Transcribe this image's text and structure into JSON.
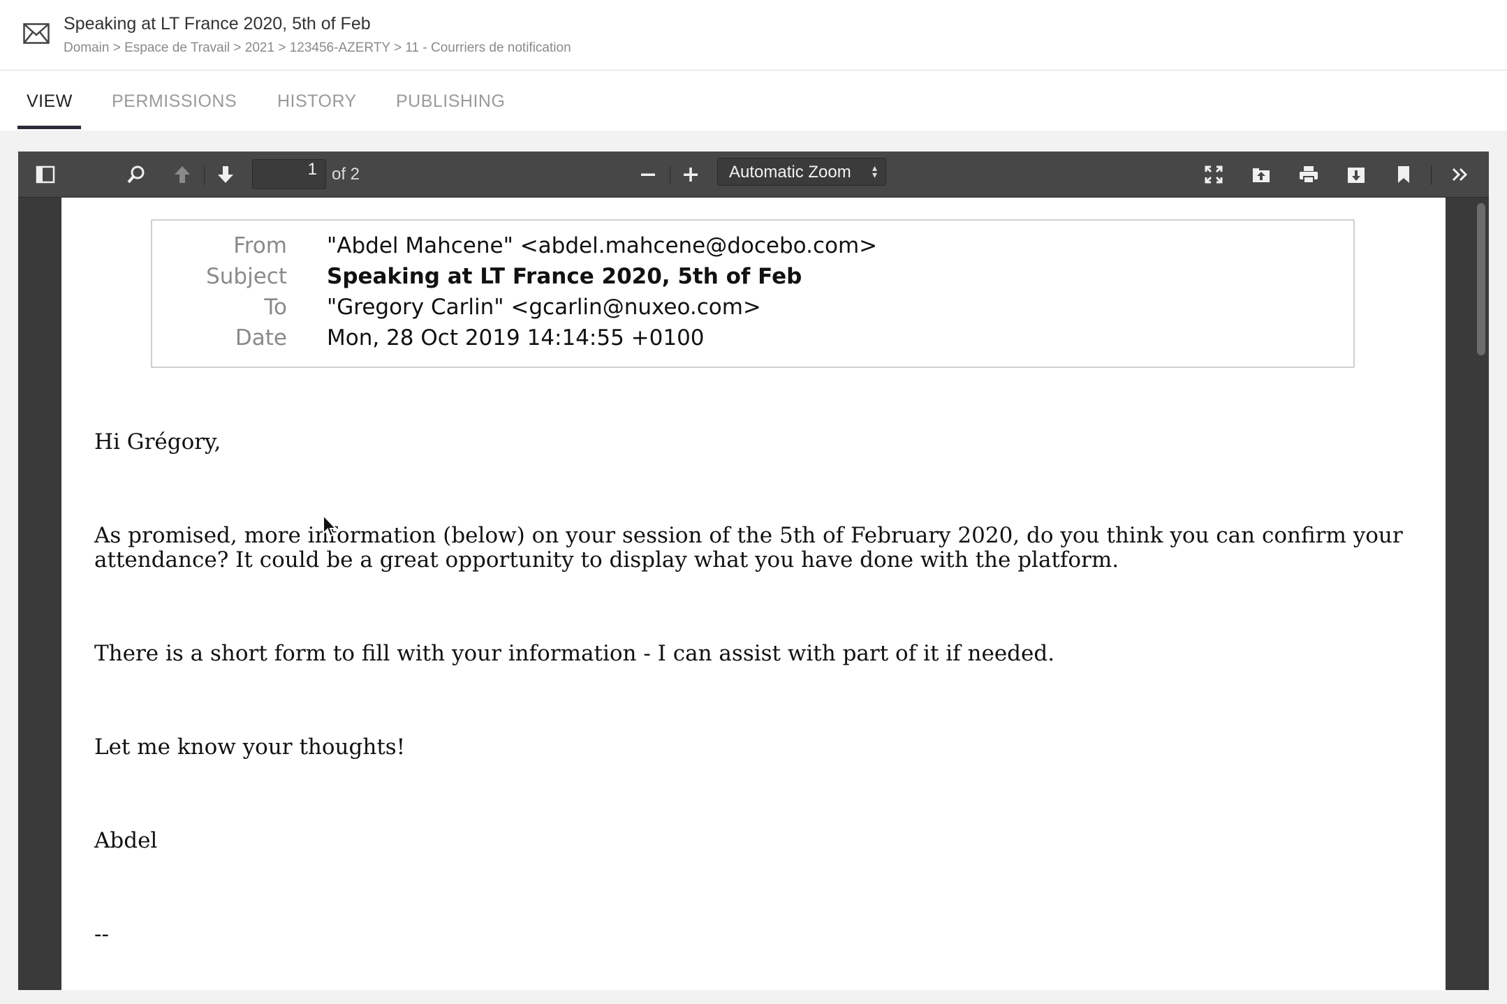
{
  "header": {
    "title": "Speaking at LT France 2020, 5th of Feb",
    "breadcrumb": "Domain > Espace de Travail > 2021 > 123456-AZERTY > 11 - Courriers de notification",
    "icon": "envelope-icon"
  },
  "tabs": [
    {
      "label": "VIEW",
      "active": true
    },
    {
      "label": "PERMISSIONS",
      "active": false
    },
    {
      "label": "HISTORY",
      "active": false
    },
    {
      "label": "PUBLISHING",
      "active": false
    }
  ],
  "viewer": {
    "toolbar": {
      "page_current": "1",
      "page_count": "of 2",
      "zoom": "Automatic Zoom",
      "icons": [
        "sidebar-toggle-icon",
        "search-icon",
        "previous-page-icon",
        "next-page-icon",
        "zoom-out-icon",
        "zoom-in-icon",
        "presentation-mode-icon",
        "open-file-icon",
        "print-icon",
        "download-icon",
        "bookmark-icon",
        "tools-icon"
      ]
    },
    "email": {
      "from_label": "From",
      "from_value": "\"Abdel Mahcene\" <abdel.mahcene@docebo.com>",
      "subject_label": "Subject",
      "subject_value": "Speaking at LT France 2020, 5th of Feb",
      "to_label": "To",
      "to_value": "\"Gregory Carlin\" <gcarlin@nuxeo.com>",
      "date_label": "Date",
      "date_value": "Mon, 28 Oct 2019 14:14:55 +0100"
    },
    "body": {
      "greeting": "Hi Grégory,",
      "para1_line1": "As promised, more information (below) on your session of the 5th of February 2020, do you think you can confirm your",
      "para1_line2": "attendance? It could be a great opportunity to display what you have done with the platform.",
      "para2": "There is a short form to fill with your information - I can assist with part of it if needed.",
      "para3": "Let me know your thoughts!",
      "signature": "Abdel",
      "separator": "--"
    }
  },
  "colors": {
    "toolbar_bg": "#474747",
    "viewer_bg": "#3a3a3a",
    "tab_active": "#222222",
    "tab_inactive": "#9a9a9a"
  }
}
